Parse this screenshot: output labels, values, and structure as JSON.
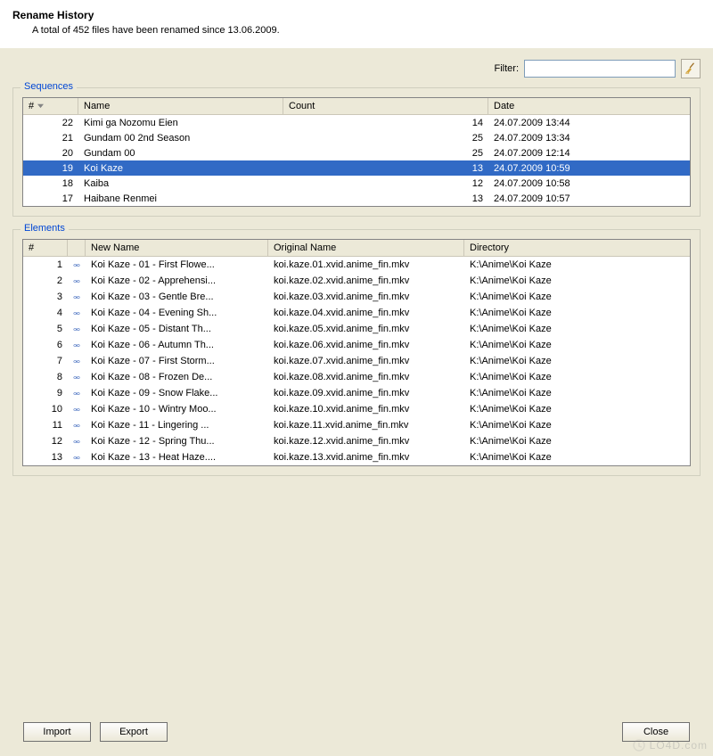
{
  "header": {
    "title": "Rename History",
    "subtitle": "A total of 452 files have been renamed since 13.06.2009."
  },
  "filter": {
    "label": "Filter:",
    "value": ""
  },
  "sequences": {
    "group_label": "Sequences",
    "columns": {
      "num": "#",
      "name": "Name",
      "count": "Count",
      "date": "Date"
    },
    "rows": [
      {
        "num": "22",
        "name": "Kimi ga Nozomu Eien",
        "count": "14",
        "date": "24.07.2009 13:44",
        "selected": false
      },
      {
        "num": "21",
        "name": "Gundam 00 2nd Season",
        "count": "25",
        "date": "24.07.2009 13:34",
        "selected": false
      },
      {
        "num": "20",
        "name": "Gundam 00",
        "count": "25",
        "date": "24.07.2009 12:14",
        "selected": false
      },
      {
        "num": "19",
        "name": "Koi Kaze",
        "count": "13",
        "date": "24.07.2009 10:59",
        "selected": true
      },
      {
        "num": "18",
        "name": "Kaiba",
        "count": "12",
        "date": "24.07.2009 10:58",
        "selected": false
      },
      {
        "num": "17",
        "name": "Haibane Renmei",
        "count": "13",
        "date": "24.07.2009 10:57",
        "selected": false
      }
    ]
  },
  "elements": {
    "group_label": "Elements",
    "columns": {
      "num": "#",
      "new_name": "New Name",
      "orig_name": "Original Name",
      "dir": "Directory"
    },
    "rows": [
      {
        "num": "1",
        "new": "Koi Kaze - 01 - First Flowe...",
        "orig": "koi.kaze.01.xvid.anime_fin.mkv",
        "dir": "K:\\Anime\\Koi Kaze"
      },
      {
        "num": "2",
        "new": "Koi Kaze - 02 - Apprehensi...",
        "orig": "koi.kaze.02.xvid.anime_fin.mkv",
        "dir": "K:\\Anime\\Koi Kaze"
      },
      {
        "num": "3",
        "new": "Koi Kaze - 03 - Gentle Bre...",
        "orig": "koi.kaze.03.xvid.anime_fin.mkv",
        "dir": "K:\\Anime\\Koi Kaze"
      },
      {
        "num": "4",
        "new": "Koi Kaze - 04 - Evening Sh...",
        "orig": "koi.kaze.04.xvid.anime_fin.mkv",
        "dir": "K:\\Anime\\Koi Kaze"
      },
      {
        "num": "5",
        "new": "Koi Kaze - 05 - Distant Th...",
        "orig": "koi.kaze.05.xvid.anime_fin.mkv",
        "dir": "K:\\Anime\\Koi Kaze"
      },
      {
        "num": "6",
        "new": "Koi Kaze - 06 - Autumn Th...",
        "orig": "koi.kaze.06.xvid.anime_fin.mkv",
        "dir": "K:\\Anime\\Koi Kaze"
      },
      {
        "num": "7",
        "new": "Koi Kaze - 07 - First Storm...",
        "orig": "koi.kaze.07.xvid.anime_fin.mkv",
        "dir": "K:\\Anime\\Koi Kaze"
      },
      {
        "num": "8",
        "new": "Koi Kaze - 08 - Frozen De...",
        "orig": "koi.kaze.08.xvid.anime_fin.mkv",
        "dir": "K:\\Anime\\Koi Kaze"
      },
      {
        "num": "9",
        "new": "Koi Kaze - 09 - Snow Flake...",
        "orig": "koi.kaze.09.xvid.anime_fin.mkv",
        "dir": "K:\\Anime\\Koi Kaze"
      },
      {
        "num": "10",
        "new": "Koi Kaze - 10 - Wintry Moo...",
        "orig": "koi.kaze.10.xvid.anime_fin.mkv",
        "dir": "K:\\Anime\\Koi Kaze"
      },
      {
        "num": "11",
        "new": "Koi Kaze - 11 - Lingering ...",
        "orig": "koi.kaze.11.xvid.anime_fin.mkv",
        "dir": "K:\\Anime\\Koi Kaze"
      },
      {
        "num": "12",
        "new": "Koi Kaze - 12 - Spring Thu...",
        "orig": "koi.kaze.12.xvid.anime_fin.mkv",
        "dir": "K:\\Anime\\Koi Kaze"
      },
      {
        "num": "13",
        "new": "Koi Kaze - 13 - Heat Haze....",
        "orig": "koi.kaze.13.xvid.anime_fin.mkv",
        "dir": "K:\\Anime\\Koi Kaze"
      }
    ]
  },
  "buttons": {
    "import": "Import",
    "export": "Export",
    "close": "Close"
  },
  "watermark": "LO4D.com"
}
